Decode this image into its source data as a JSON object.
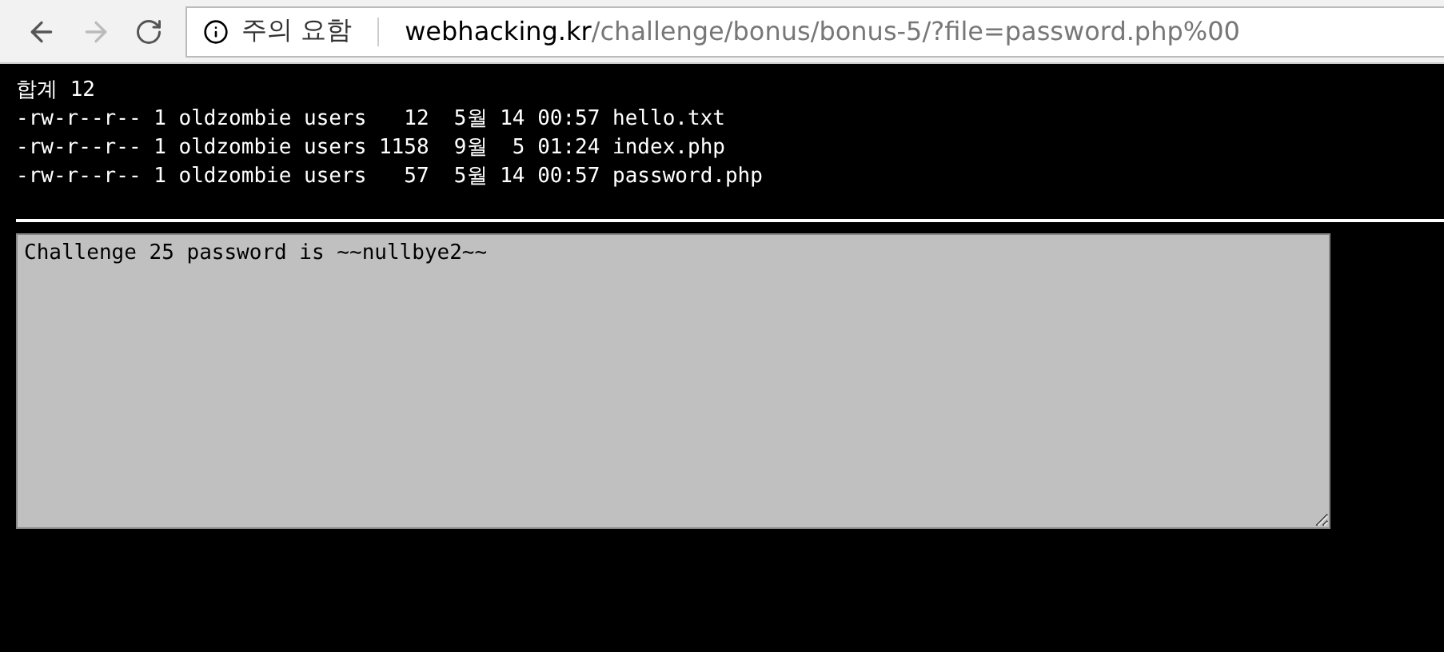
{
  "toolbar": {
    "security_label": "주의 요함",
    "url_host": "webhacking.kr",
    "url_path": "/challenge/bonus/bonus-5/?file=password.php%00"
  },
  "listing": [
    "합계 12",
    "-rw-r--r-- 1 oldzombie users   12  5월 14 00:57 hello.txt",
    "-rw-r--r-- 1 oldzombie users 1158  9월  5 01:24 index.php",
    "-rw-r--r-- 1 oldzombie users   57  5월 14 00:57 password.php"
  ],
  "textarea": {
    "value": "Challenge 25 password is ~~nullbye2~~"
  }
}
